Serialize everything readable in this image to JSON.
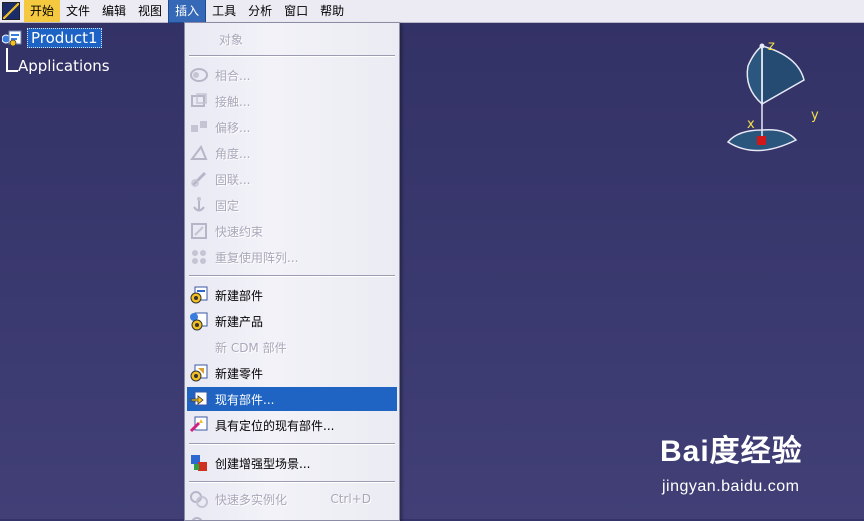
{
  "menubar": {
    "items": [
      "开始",
      "文件",
      "编辑",
      "视图",
      "插入",
      "工具",
      "分析",
      "窗口",
      "帮助"
    ]
  },
  "tree": {
    "root_label": "Product1",
    "child_label": "Applications"
  },
  "compass": {
    "z": "z",
    "y": "y",
    "x": "x"
  },
  "insert_menu": {
    "object": "对象",
    "constraints": [
      "相合...",
      "接触...",
      "偏移...",
      "角度...",
      "固联...",
      "固定",
      "快速约束",
      "重复使用阵列..."
    ],
    "new_component": "新建部件",
    "new_product": "新建产品",
    "new_cdm_component": "新 CDM 部件",
    "new_part": "新建零件",
    "existing_component": "现有部件...",
    "existing_component_positioning": "具有定位的现有部件...",
    "enhanced_scene": "创建增强型场景...",
    "fast_multi_instantiation": "快速多实例化",
    "fast_multi_instantiation_shortcut": "Ctrl+D"
  },
  "watermark": {
    "brand": "Bai度经验",
    "url": "jingyan.baidu.com"
  },
  "colors": {
    "viewport": "#35346a",
    "menu_highlight": "#f4c940",
    "selection": "#1f64c2"
  }
}
